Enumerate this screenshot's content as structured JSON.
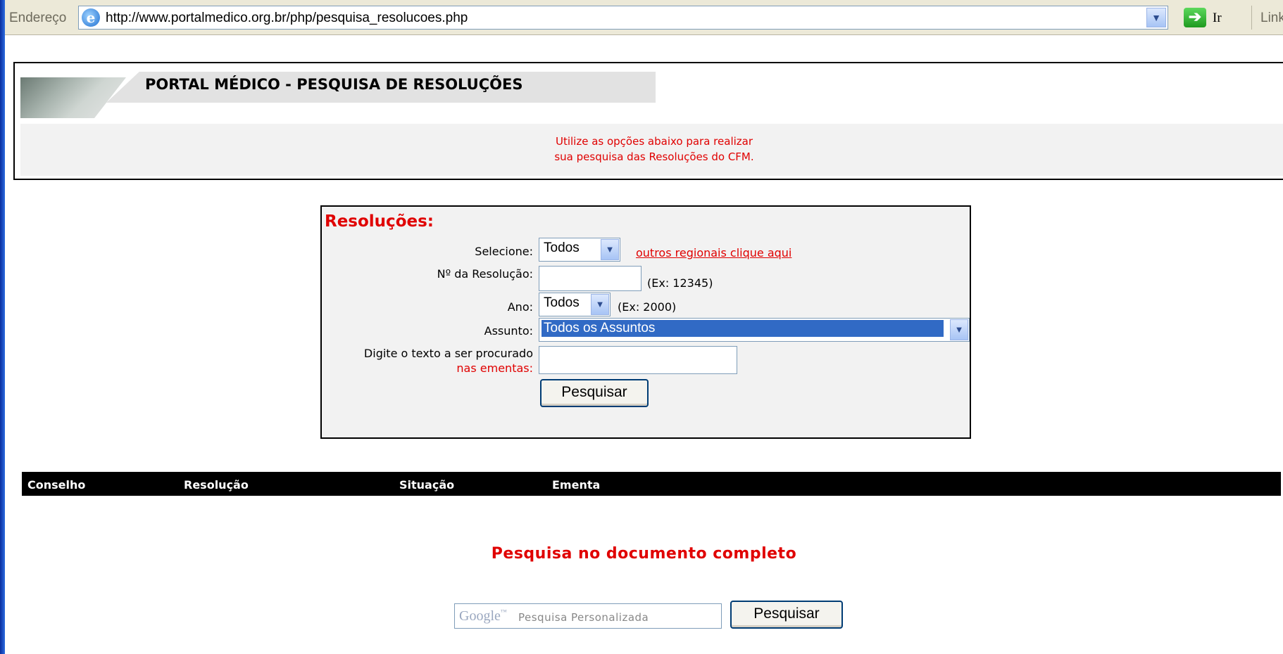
{
  "browser": {
    "address_label": "Endereço",
    "url": "http://www.portalmedico.org.br/php/pesquisa_resolucoes.php",
    "go_label": "Ir",
    "links_label": "Links"
  },
  "header": {
    "title": "PORTAL MÉDICO - PESQUISA DE RESOLUÇÕES",
    "info_line1": "Utilize as opções abaixo para realizar",
    "info_line2": "sua pesquisa das Resoluções do CFM."
  },
  "form": {
    "title": "Resoluções:",
    "selecione_label": "Selecione:",
    "selecione_value": "Todos",
    "outros_link": "outros regionais clique aqui",
    "numero_label": "Nº da Resolução:",
    "numero_value": "",
    "numero_hint": "(Ex:  12345)",
    "ano_label": "Ano:",
    "ano_value": "Todos",
    "ano_hint": "(Ex: 2000)",
    "assunto_label": "Assunto:",
    "assunto_value": "Todos os Assuntos",
    "texto_label_line1": "Digite o texto a ser procurado",
    "texto_label_line2": "nas ementas:",
    "texto_value": "",
    "submit_label": "Pesquisar"
  },
  "results": {
    "columns": [
      "Conselho",
      "Resolução",
      "Situação",
      "Ementa"
    ]
  },
  "full_search": {
    "title": "Pesquisa no documento completo",
    "google_logo": "Google",
    "google_tm": "™",
    "placeholder": "Pesquisa Personalizada",
    "button_label": "Pesquisar"
  }
}
